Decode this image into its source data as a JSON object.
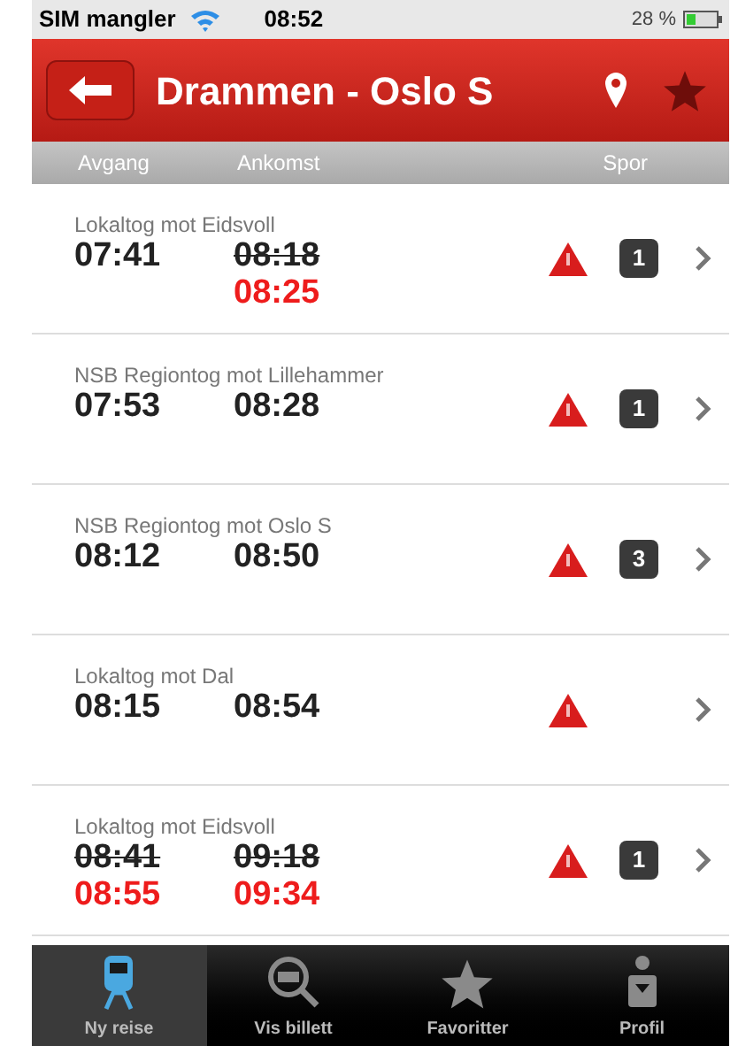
{
  "status_bar": {
    "carrier": "SIM mangler",
    "time": "08:52",
    "battery": "28 %"
  },
  "header": {
    "title": "Drammen - Oslo S",
    "favorite": false
  },
  "columns": [
    "Avgang",
    "Ankomst",
    "Spor"
  ],
  "departures": [
    {
      "train": "Lokaltog mot Eidsvoll",
      "departure": {
        "time": "07:41",
        "struck": false
      },
      "arrival": {
        "time": "08:18",
        "struck": true,
        "new": "08:25"
      },
      "warning": true,
      "track": "1"
    },
    {
      "train": "NSB Regiontog mot Lillehammer",
      "departure": {
        "time": "07:53",
        "struck": false
      },
      "arrival": {
        "time": "08:28",
        "struck": false
      },
      "warning": true,
      "track": "1"
    },
    {
      "train": "NSB Regiontog mot Oslo S",
      "departure": {
        "time": "08:12",
        "struck": false
      },
      "arrival": {
        "time": "08:50",
        "struck": false
      },
      "warning": true,
      "track": "3"
    },
    {
      "train": "Lokaltog mot Dal",
      "departure": {
        "time": "08:15",
        "struck": false
      },
      "arrival": {
        "time": "08:54",
        "struck": false
      },
      "warning": true
    },
    {
      "train": "Lokaltog mot Eidsvoll",
      "departure": {
        "time": "08:41",
        "struck": true,
        "new": "08:55"
      },
      "arrival": {
        "time": "09:18",
        "struck": true,
        "new": "09:34"
      },
      "warning": true,
      "track": "1"
    }
  ],
  "tab_bar": [
    {
      "kind": "train",
      "label": "Ny reise",
      "selected": true
    },
    {
      "kind": "ticket",
      "label": "Vis billett",
      "selected": false
    },
    {
      "kind": "star",
      "label": "Favoritter",
      "selected": false
    },
    {
      "kind": "profile",
      "label": "Profil",
      "selected": false
    }
  ]
}
